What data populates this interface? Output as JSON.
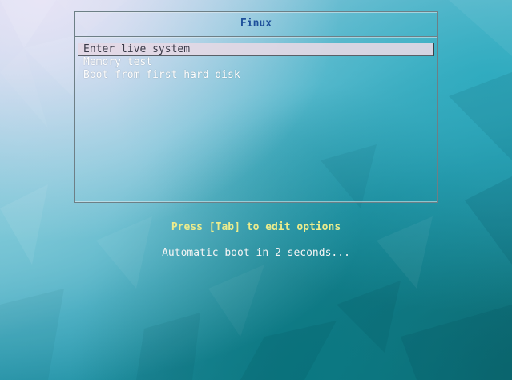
{
  "menu": {
    "title": "Finux",
    "items": [
      {
        "label": "Enter live system",
        "selected": true
      },
      {
        "label": "Memory test",
        "selected": false
      },
      {
        "label": "Boot from first hard disk",
        "selected": false
      }
    ]
  },
  "hints": {
    "edit_options": "Press [Tab] to edit options",
    "autoboot": "Automatic boot in 2 seconds..."
  },
  "colors": {
    "title": "#1d4f9a",
    "hint_highlight": "#ecec8c",
    "menu_text": "#ffffff",
    "selection_bg": "#e4d8e4"
  }
}
